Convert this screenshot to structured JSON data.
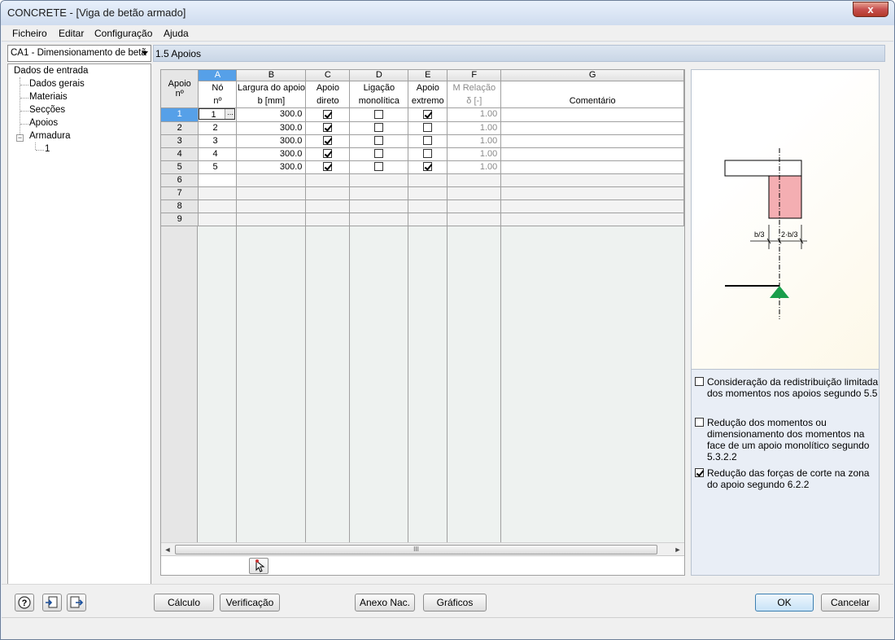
{
  "window": {
    "title": "CONCRETE - [Viga de betão armado]",
    "close_label": "x"
  },
  "menu": [
    "Ficheiro",
    "Editar",
    "Configuração",
    "Ajuda"
  ],
  "nav": {
    "dropdown": "CA1 - Dimensionamento de betã",
    "tree": {
      "root": "Dados de entrada",
      "items": [
        "Dados gerais",
        "Materiais",
        "Secções",
        "Apoios"
      ],
      "armadura": "Armadura",
      "armadura_child": "1",
      "expander": "−"
    }
  },
  "section": {
    "title": "1.5 Apoios"
  },
  "table": {
    "col_letters": [
      "A",
      "B",
      "C",
      "D",
      "E",
      "F",
      "G"
    ],
    "rowhead_header": [
      "Apoio",
      "nº"
    ],
    "headers": [
      [
        "Nó",
        "nº"
      ],
      [
        "Largura do apoio",
        "b [mm]"
      ],
      [
        "Apoio",
        "direto"
      ],
      [
        "Ligação",
        "monolítica"
      ],
      [
        "Apoio",
        "extremo"
      ],
      [
        "M Relação",
        "δ [-]"
      ],
      [
        "",
        "Comentário"
      ]
    ],
    "rows": [
      {
        "num": "1",
        "node": "1",
        "width": "300.0",
        "direto": true,
        "monolitica": false,
        "extremo": true,
        "relacao": "1.00"
      },
      {
        "num": "2",
        "node": "2",
        "width": "300.0",
        "direto": true,
        "monolitica": false,
        "extremo": false,
        "relacao": "1.00"
      },
      {
        "num": "3",
        "node": "3",
        "width": "300.0",
        "direto": true,
        "monolitica": false,
        "extremo": false,
        "relacao": "1.00"
      },
      {
        "num": "4",
        "node": "4",
        "width": "300.0",
        "direto": true,
        "monolitica": false,
        "extremo": false,
        "relacao": "1.00"
      },
      {
        "num": "5",
        "node": "5",
        "width": "300.0",
        "direto": true,
        "monolitica": false,
        "extremo": true,
        "relacao": "1.00"
      }
    ],
    "empty_rows": [
      "6",
      "7",
      "8",
      "9"
    ],
    "ellipsis": "...",
    "scroll_grip": "III",
    "scroll_left": "◄",
    "scroll_right": "►"
  },
  "diagram": {
    "label_left": "b/3",
    "label_right": "2·b/3",
    "support_color": "#1a9e4b",
    "column_color": "#f4aeb2"
  },
  "options": [
    {
      "text": "Consideração da redistribuição limitada dos momentos nos apoios segundo 5.5",
      "checked": false
    },
    {
      "text": "Redução dos momentos ou dimensionamento dos momentos na face de um apoio monolítico segundo 5.3.2.2",
      "checked": false
    },
    {
      "text": "Redução das forças de corte na zona do apoio segundo 6.2.2",
      "checked": true
    }
  ],
  "buttons": {
    "calculo": "Cálculo",
    "verificacao": "Verificação",
    "anexo": "Anexo Nac. ...",
    "graficos": "Gráficos",
    "ok": "OK",
    "cancelar": "Cancelar"
  }
}
